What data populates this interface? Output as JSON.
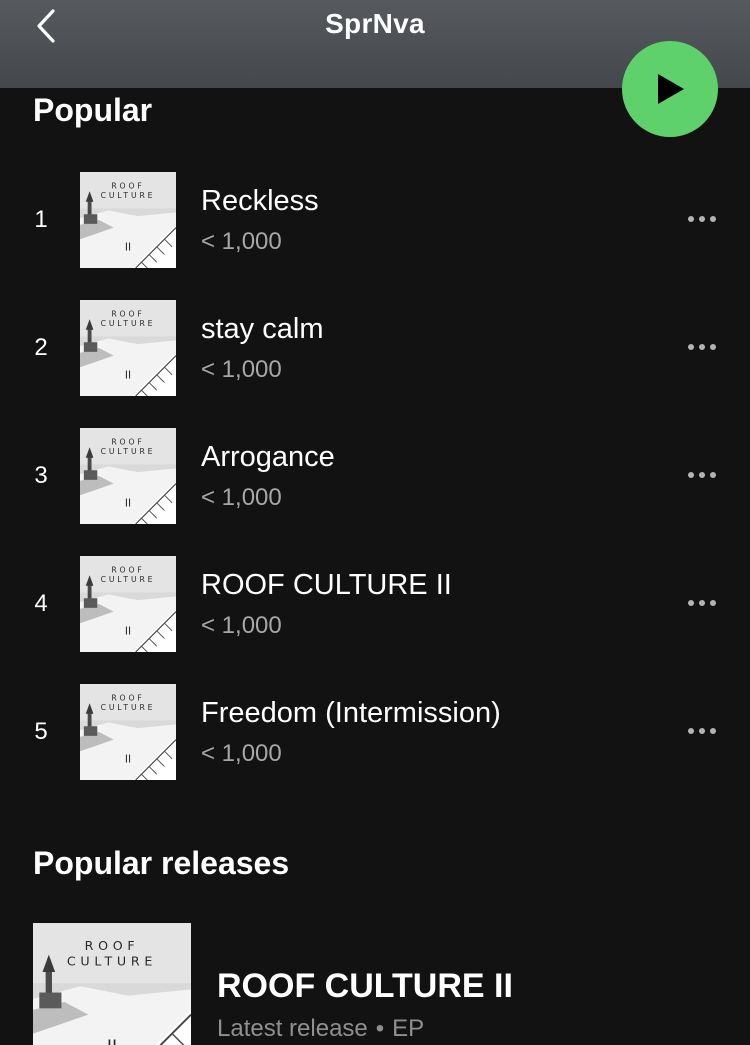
{
  "header": {
    "title": "SprNva",
    "back_icon": "chevron-left-icon"
  },
  "play_button": {
    "icon": "play-icon",
    "color": "#5ed16d"
  },
  "popular": {
    "title": "Popular",
    "tracks": [
      {
        "number": "1",
        "title": "Reckless",
        "plays": "< 1,000",
        "art_text": [
          "ROOF",
          "CULTURE",
          "II"
        ]
      },
      {
        "number": "2",
        "title": "stay calm",
        "plays": "< 1,000",
        "art_text": [
          "ROOF",
          "CULTURE",
          "II"
        ]
      },
      {
        "number": "3",
        "title": "Arrogance",
        "plays": "< 1,000",
        "art_text": [
          "ROOF",
          "CULTURE",
          "II"
        ]
      },
      {
        "number": "4",
        "title": "ROOF CULTURE II",
        "plays": "< 1,000",
        "art_text": [
          "ROOF",
          "CULTURE",
          "II"
        ]
      },
      {
        "number": "5",
        "title": "Freedom (Intermission)",
        "plays": "< 1,000",
        "art_text": [
          "ROOF",
          "CULTURE",
          "II"
        ]
      }
    ]
  },
  "popular_releases": {
    "title": "Popular releases",
    "items": [
      {
        "title": "ROOF CULTURE II",
        "label": "Latest release",
        "separator": "•",
        "type": "EP",
        "art_text": [
          "ROOF",
          "CULTURE",
          "II"
        ]
      }
    ]
  }
}
